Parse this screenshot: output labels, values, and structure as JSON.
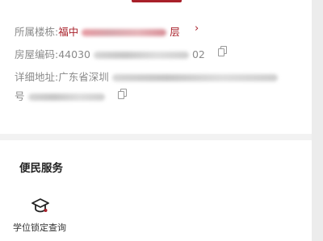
{
  "info": {
    "building_label": "所属楼栋:",
    "building_value_prefix": "福中",
    "building_value_suffix": "层",
    "code_label": "房屋编码:",
    "code_prefix": "44030",
    "code_suffix": "02",
    "address_label": "详细地址:",
    "address_prefix": "广东省深圳",
    "row4_prefix": "号"
  },
  "services": {
    "section_title": "便民服务",
    "items": [
      {
        "label": "学位锁定查询",
        "icon": "graduation-cap-icon"
      }
    ]
  },
  "colors": {
    "accent": "#a8202a",
    "label": "#8a8a8a"
  }
}
